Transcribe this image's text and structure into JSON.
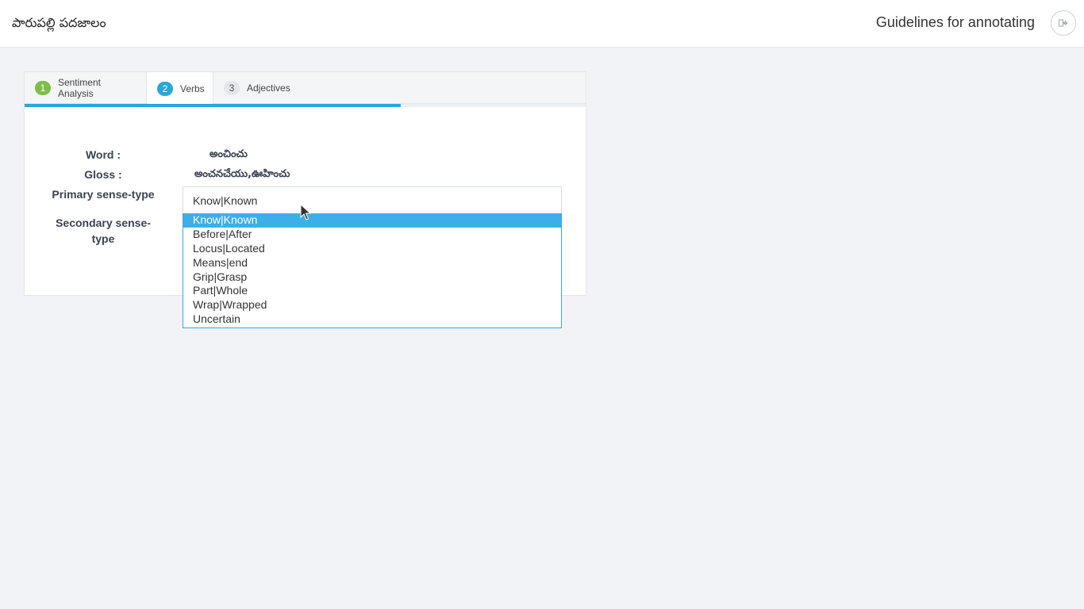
{
  "header": {
    "app_title": "పారుపల్లి పదజాలం",
    "guidelines_link": "Guidelines for annotating",
    "logout_icon": "logout-icon"
  },
  "tabs": [
    {
      "number": "1",
      "label": "Sentiment Analysis",
      "state": "completed"
    },
    {
      "number": "2",
      "label": "Verbs",
      "state": "active"
    },
    {
      "number": "3",
      "label": "Adjectives",
      "state": "pending"
    }
  ],
  "progress": {
    "percent": 67
  },
  "form": {
    "word_label": "Word :",
    "word_value": "అంచించు",
    "gloss_label": "Gloss :",
    "gloss_value": "అంచనచేయు,ఊహించు",
    "primary_label": "Primary sense-type",
    "primary_selected": "Know|Known",
    "secondary_label": "Secondary sense-\ntype"
  },
  "dropdown": {
    "options": [
      "Know|Known",
      "Before|After",
      "Locus|Located",
      "Means|end",
      "Grip|Grasp",
      "Part|Whole",
      "Wrap|Wrapped",
      "Uncertain"
    ],
    "highlighted_index": 0
  },
  "colors": {
    "accent_blue": "#2aa6d8",
    "completed_green": "#7ebf4a",
    "highlight": "#3eaee8"
  }
}
